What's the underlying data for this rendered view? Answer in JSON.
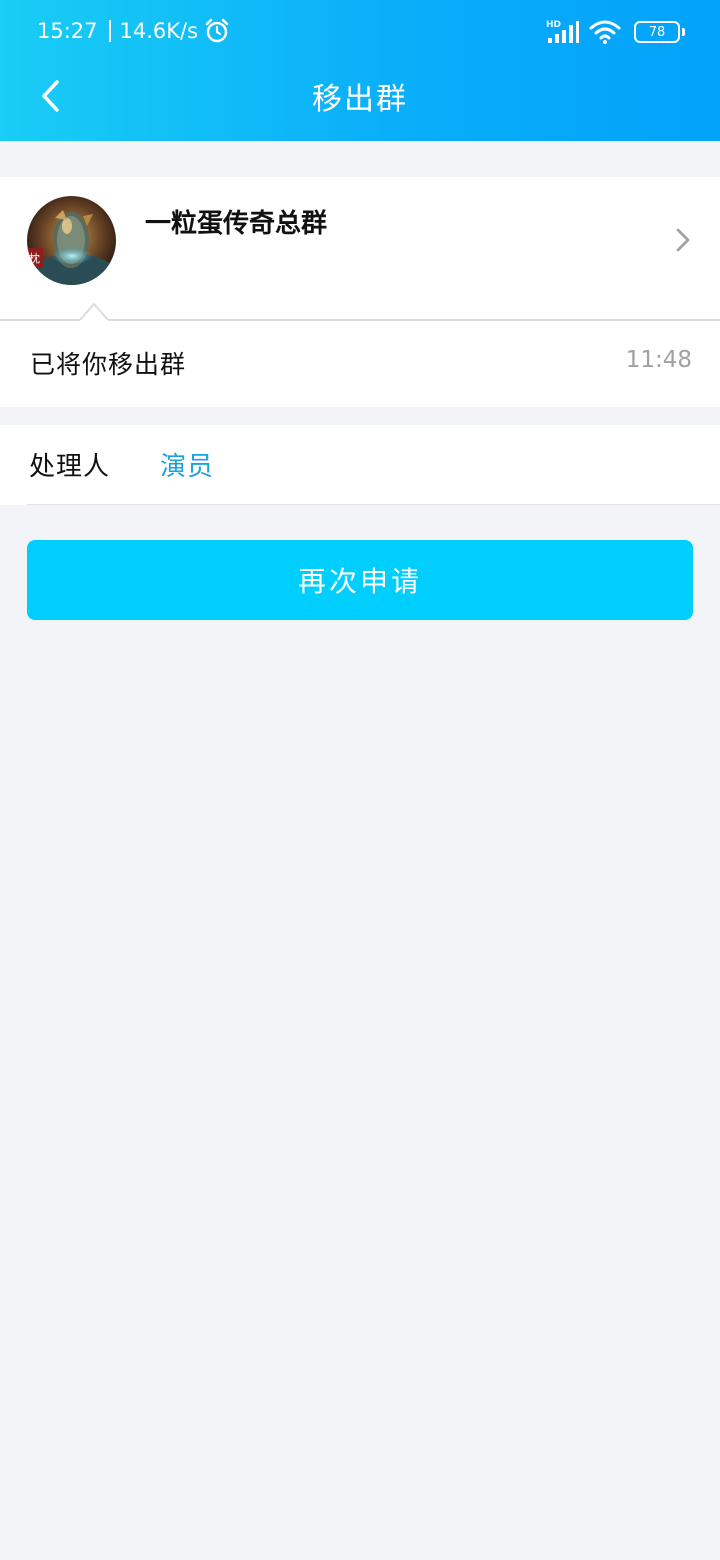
{
  "status_bar": {
    "time": "15:27",
    "network_speed": "14.6K/s",
    "signal_label": "HD",
    "battery_level": "78",
    "icons": [
      "alarm-icon",
      "signal-icon",
      "wifi-icon",
      "battery-icon"
    ]
  },
  "header": {
    "title": "移出群",
    "back_icon": "chevron-left-icon",
    "gradient_colors": [
      "#19cdf5",
      "#03a2fb"
    ]
  },
  "group": {
    "name": "一粒蛋传奇总群",
    "chevron_icon": "chevron-right-icon"
  },
  "message": {
    "text": "已将你移出群",
    "time": "11:48"
  },
  "handler": {
    "label": "处理人",
    "value": "演员",
    "value_color": "#1aa3e0"
  },
  "actions": {
    "reapply_label": "再次申请",
    "button_color": "#00cffe"
  }
}
